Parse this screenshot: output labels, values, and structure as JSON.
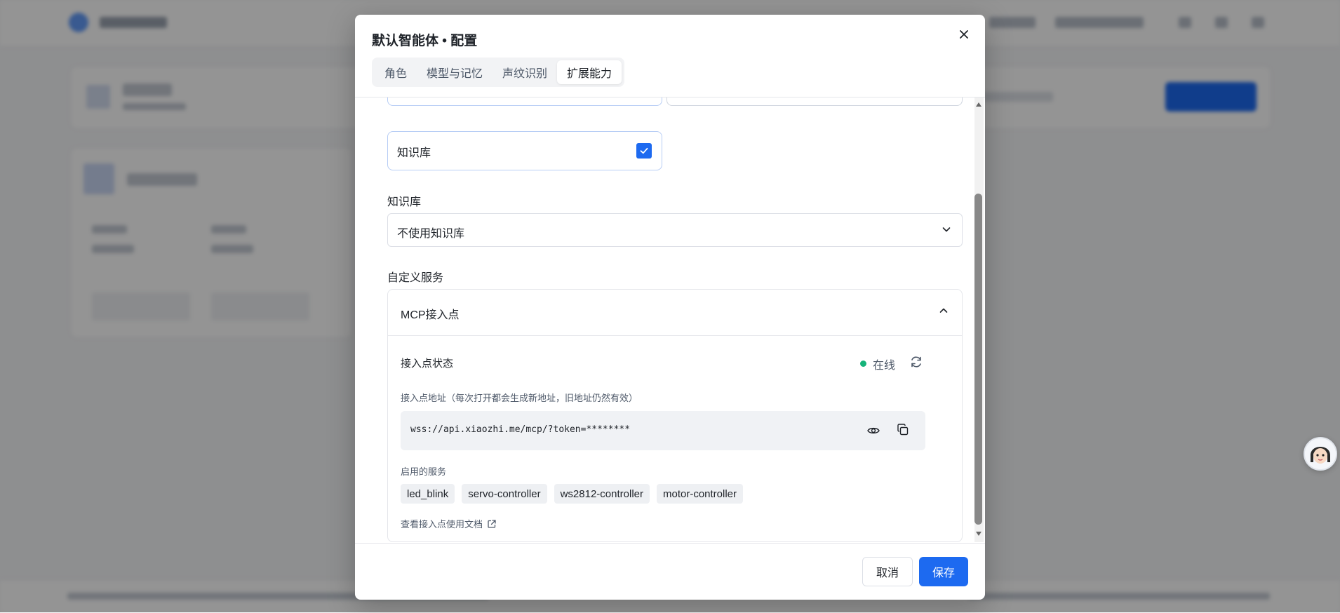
{
  "dialog": {
    "title": "默认智能体 • 配置",
    "tabs": [
      {
        "label": "角色"
      },
      {
        "label": "模型与记忆"
      },
      {
        "label": "声纹识别"
      },
      {
        "label": "扩展能力",
        "active": true
      }
    ]
  },
  "capabilities": {
    "knowledge_base": {
      "label": "知识库",
      "checked": true
    }
  },
  "knowledge": {
    "label": "知识库",
    "selected": "不使用知识库"
  },
  "custom_service": {
    "label": "自定义服务",
    "panel_title": "MCP接入点",
    "status_label": "接入点状态",
    "status_value": "在线",
    "url_label": "接入点地址（每次打开都会生成新地址，旧地址仍然有效）",
    "url": "wss://api.xiaozhi.me/mcp/?token=********",
    "services_label": "启用的服务",
    "services": [
      "led_blink",
      "servo-controller",
      "ws2812-controller",
      "motor-controller"
    ],
    "doc_link": "查看接入点使用文档"
  },
  "footer": {
    "cancel": "取消",
    "save": "保存"
  },
  "colors": {
    "primary": "#1d6af0",
    "online": "#16b37a"
  }
}
